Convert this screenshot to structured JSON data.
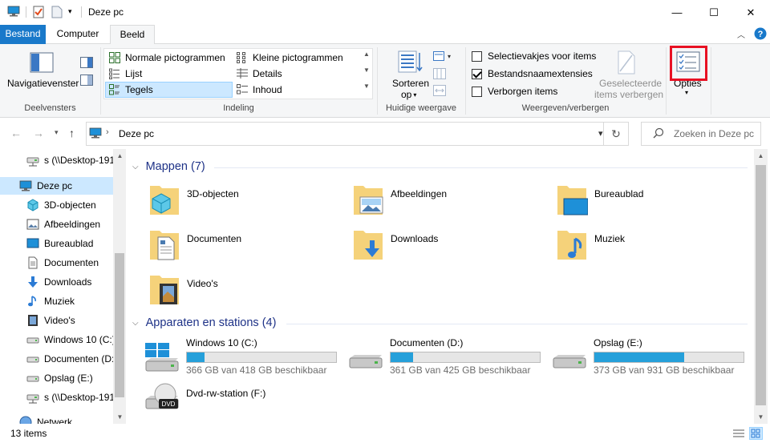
{
  "window": {
    "title": "Deze pc",
    "minimize": "—",
    "maximize": "☐",
    "close": "✕"
  },
  "ribbon_tabs": [
    "Bestand",
    "Computer",
    "Beeld"
  ],
  "ribbon": {
    "deelvensters": {
      "label": "Deelvensters",
      "nav_pane": "Navigatievenster"
    },
    "indeling": {
      "label": "Indeling",
      "items": [
        "Normale pictogrammen",
        "Kleine pictogrammen",
        "Lijst",
        "Details",
        "Tegels",
        "Inhoud"
      ],
      "selected": "Tegels"
    },
    "huidige_weergave": {
      "label": "Huidige weergave",
      "sort_line1": "Sorteren",
      "sort_line2": "op"
    },
    "weergeven_verbergen": {
      "label": "Weergeven/verbergen",
      "checkboxes": [
        {
          "label": "Selectievakjes voor items",
          "checked": false
        },
        {
          "label": "Bestandsnaamextensies",
          "checked": true
        },
        {
          "label": "Verborgen items",
          "checked": false
        }
      ],
      "hide_selected_line1": "Geselecteerde",
      "hide_selected_line2": "items verbergen"
    },
    "opties": "Opties",
    "highlight_color": "#e81123"
  },
  "address": {
    "path": "Deze pc",
    "search_placeholder": "Zoeken in Deze pc"
  },
  "nav_pane": {
    "items": [
      {
        "label": "s (\\\\Desktop-191",
        "icon": "network-drive-icon"
      },
      {
        "label": "Deze pc",
        "icon": "computer-icon",
        "selected": true
      },
      {
        "label": "3D-objecten",
        "icon": "3d-objects-icon"
      },
      {
        "label": "Afbeeldingen",
        "icon": "pictures-icon"
      },
      {
        "label": "Bureaublad",
        "icon": "desktop-icon"
      },
      {
        "label": "Documenten",
        "icon": "documents-icon"
      },
      {
        "label": "Downloads",
        "icon": "downloads-icon"
      },
      {
        "label": "Muziek",
        "icon": "music-icon"
      },
      {
        "label": "Video's",
        "icon": "videos-icon"
      },
      {
        "label": "Windows 10 (C:)",
        "icon": "drive-icon"
      },
      {
        "label": "Documenten (D:",
        "icon": "drive-icon"
      },
      {
        "label": "Opslag (E:)",
        "icon": "drive-icon"
      },
      {
        "label": "s (\\\\Desktop-191",
        "icon": "network-drive-icon"
      },
      {
        "label": "Netwerk",
        "icon": "network-icon"
      }
    ]
  },
  "content": {
    "folders_header": "Mappen (7)",
    "folders": [
      {
        "name": "3D-objecten",
        "icon": "3d-objects-icon"
      },
      {
        "name": "Afbeeldingen",
        "icon": "pictures-icon"
      },
      {
        "name": "Bureaublad",
        "icon": "desktop-icon"
      },
      {
        "name": "Documenten",
        "icon": "documents-icon"
      },
      {
        "name": "Downloads",
        "icon": "downloads-icon"
      },
      {
        "name": "Muziek",
        "icon": "music-icon"
      },
      {
        "name": "Video's",
        "icon": "videos-icon"
      }
    ],
    "devices_header": "Apparaten en stations (4)",
    "drives": [
      {
        "name": "Windows 10 (C:)",
        "info": "366 GB van 418 GB beschikbaar",
        "used_fraction": 0.12,
        "icon": "windows-drive-icon"
      },
      {
        "name": "Documenten (D:)",
        "info": "361 GB van 425 GB beschikbaar",
        "used_fraction": 0.15,
        "icon": "hdd-icon"
      },
      {
        "name": "Opslag (E:)",
        "info": "373 GB van 931 GB beschikbaar",
        "used_fraction": 0.6,
        "icon": "hdd-icon"
      },
      {
        "name": "Dvd-rw-station (F:)",
        "icon": "dvd-drive-icon"
      }
    ]
  },
  "status": {
    "item_count": "13 items"
  }
}
